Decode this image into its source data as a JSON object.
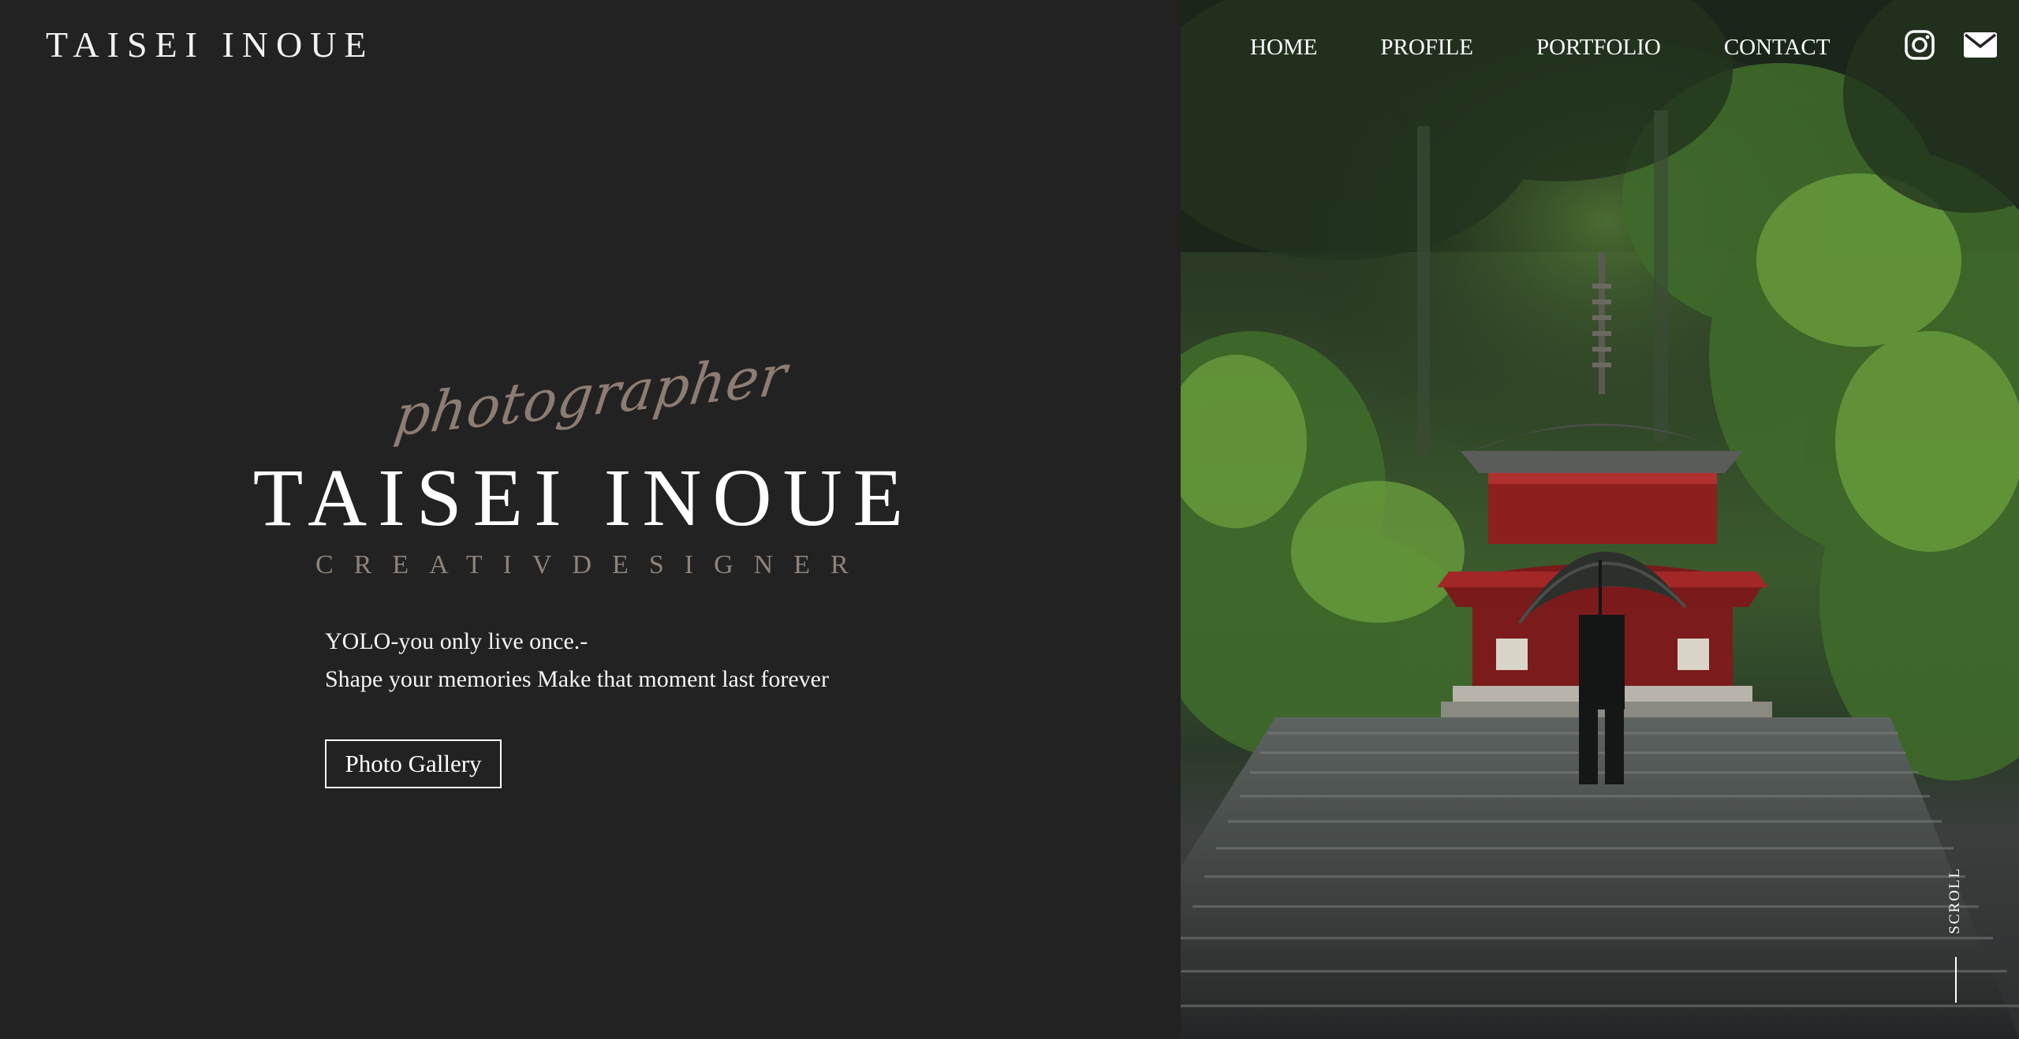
{
  "header": {
    "logo": "TAISEI INOUE",
    "nav": [
      "HOME",
      "PROFILE",
      "PORTFOLIO",
      "CONTACT"
    ],
    "icons": [
      "instagram-icon",
      "mail-icon"
    ]
  },
  "hero": {
    "script_word": "photographer",
    "name": "TAISEI INOUE",
    "subtitle": "CREATIVDESIGNER",
    "tagline_line1": "YOLO-you only live once.-",
    "tagline_line2": "Shape your memories Make that moment last forever",
    "button_label": "Photo Gallery"
  },
  "scroll": {
    "label": "SCROLL"
  },
  "colors": {
    "background": "#222222",
    "script_accent": "#a08c80",
    "subtitle": "#8f8379",
    "pagoda_red": "#8e1f1f",
    "text": "#ffffff"
  }
}
